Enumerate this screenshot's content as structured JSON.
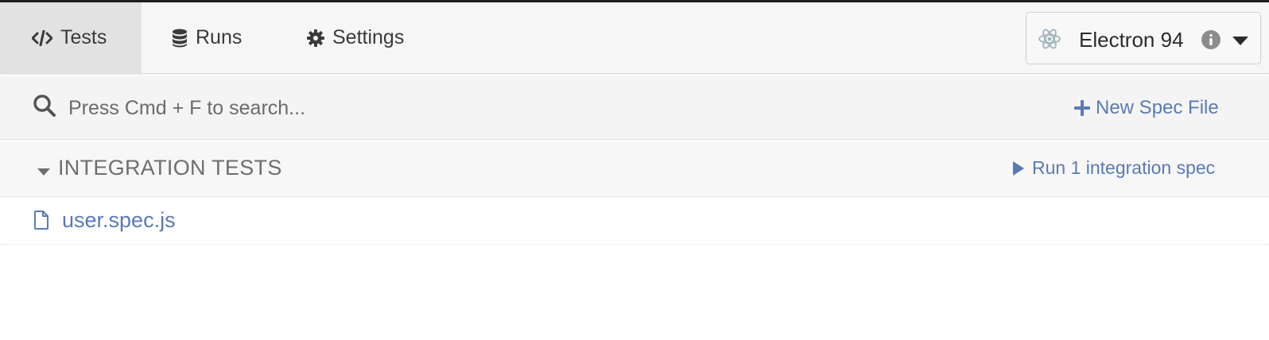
{
  "nav": {
    "tabs": [
      {
        "label": "Tests",
        "icon": "code-icon",
        "active": true
      },
      {
        "label": "Runs",
        "icon": "database-icon",
        "active": false
      },
      {
        "label": "Settings",
        "icon": "gear-icon",
        "active": false
      }
    ]
  },
  "browser": {
    "label": "Electron 94",
    "icon": "electron-icon"
  },
  "search": {
    "placeholder": "Press Cmd + F to search...",
    "value": ""
  },
  "actions": {
    "new_spec_label": "New Spec File"
  },
  "section": {
    "title": "INTEGRATION TESTS",
    "run_label": "Run 1 integration spec"
  },
  "specs": [
    {
      "name": "user.spec.js",
      "icon": "file-icon"
    }
  ],
  "colors": {
    "link": "#5a7ab6",
    "active_tab_bg": "#e2e2e2",
    "navbar_bg": "#f6f6f6"
  }
}
